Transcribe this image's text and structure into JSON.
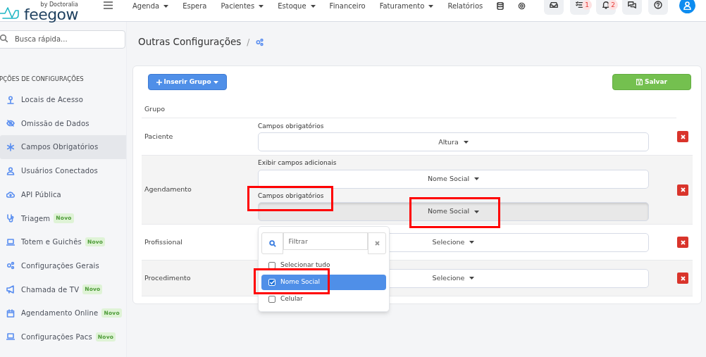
{
  "header": {
    "logo": "feegow",
    "logo_sub": "by Doctoralia",
    "nav": [
      {
        "label": "Agenda",
        "caret": true
      },
      {
        "label": "Espera",
        "caret": false
      },
      {
        "label": "Pacientes",
        "caret": true
      },
      {
        "label": "Estoque",
        "caret": true
      },
      {
        "label": "Financeiro",
        "caret": false
      },
      {
        "label": "Faturamento",
        "caret": true
      },
      {
        "label": "Relatórios",
        "caret": false
      }
    ],
    "tools": [
      {
        "kind": "inbox"
      },
      {
        "kind": "tasks",
        "badge": "1"
      },
      {
        "kind": "bell",
        "badge": "2"
      },
      {
        "kind": "chat"
      },
      {
        "kind": "help"
      }
    ]
  },
  "sidebar": {
    "search_placeholder": "Busca rápida...",
    "heading": "PÇÕES DE CONFIGURAÇÕES",
    "items": [
      {
        "label": "Locais de Acesso",
        "selected": false
      },
      {
        "label": "Omissão de Dados",
        "selected": false
      },
      {
        "label": "Campos Obrigatórios",
        "selected": true
      },
      {
        "label": "Usuários Conectados",
        "selected": false
      },
      {
        "label": "API Pública",
        "selected": false
      },
      {
        "label": "Triagem",
        "selected": false,
        "badge": "Novo"
      },
      {
        "label": "Totem e Guichês",
        "selected": false,
        "badge": "Novo"
      },
      {
        "label": "Configurações Gerais",
        "selected": false
      },
      {
        "label": "Chamada de TV",
        "selected": false,
        "badge": "Novo"
      },
      {
        "label": "Agendamento Online",
        "selected": false,
        "badge": "Novo"
      },
      {
        "label": "Configurações Pacs",
        "selected": false,
        "badge": "Novo"
      }
    ]
  },
  "page": {
    "title": "Outras Configurações",
    "separator": "/",
    "add_button": "Inserir Grupo",
    "save_button": "Salvar",
    "column": "Grupo",
    "groups": [
      {
        "name": "Paciente",
        "fields": [
          {
            "label": "Campos obrigatórios",
            "value": "Altura",
            "focused": false
          }
        ]
      },
      {
        "name": "Agendamento",
        "fields": [
          {
            "label": "Exibir campos adicionais",
            "value": "Nome Social",
            "focused": false
          },
          {
            "label": "Campos obrigatórios",
            "value": "Nome Social",
            "focused": true
          }
        ]
      },
      {
        "name": "Profissional",
        "fields": [
          {
            "value": "Selecione",
            "focused": false
          }
        ]
      },
      {
        "name": "Procedimento",
        "fields": [
          {
            "value": "Selecione",
            "focused": false
          }
        ]
      }
    ]
  },
  "dropdown": {
    "filter_placeholder": "Filtrar",
    "options": [
      {
        "label": "Selecionar tudo",
        "checked": false,
        "selected": false
      },
      {
        "label": "Nome Social",
        "checked": true,
        "selected": true
      },
      {
        "label": "Celular",
        "checked": false,
        "selected": false
      }
    ]
  }
}
